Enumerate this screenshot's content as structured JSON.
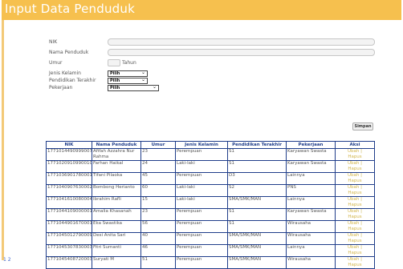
{
  "title": "Input Data Penduduk",
  "form": {
    "nik_label": "NIK",
    "nama_label": "Nama Penduduk",
    "umur_label": "Umur",
    "umur_unit": "Tahun",
    "jk_label": "Jenis Kelamin",
    "jk_value": "Pilih",
    "pendidikan_label": "Pendidikan Terakhir",
    "pendidikan_value": "Pilih",
    "pekerjaan_label": "Pekerjaan",
    "pekerjaan_value": "Pilih",
    "simpan_label": "Simpan"
  },
  "table": {
    "headers": [
      "NIK",
      "Nama Penduduk",
      "Umur",
      "Jenis Kelamin",
      "Pendidikan Terakhir",
      "Pekerjaan",
      "Aksi"
    ],
    "ubah_label": "Ubah",
    "separator": "|",
    "hapus_label": "Hapus",
    "rows": [
      {
        "nik": "1771014490999007",
        "nama": "Afifah Azzahra Nur Rahma",
        "umur": "23",
        "jk": "Perempuan",
        "pend": "S1",
        "kerja": "Karyawan Swasta"
      },
      {
        "nik": "1771020910990010",
        "nama": "Farhan Haikal",
        "umur": "24",
        "jk": "Laki-laki",
        "pend": "S1",
        "kerja": "Karyawan Swasta"
      },
      {
        "nik": "1771036901780001",
        "nama": "Tifani Pilaoka",
        "umur": "45",
        "jk": "Perempuan",
        "pend": "D3",
        "kerja": "Lainnya"
      },
      {
        "nik": "1771040907630002",
        "nama": "Bombong Herianto",
        "umur": "60",
        "jk": "Laki-laki",
        "pend": "S2",
        "kerja": "PNS"
      },
      {
        "nik": "1771041610080004",
        "nama": "Ibrahim Rafli",
        "umur": "15",
        "jk": "Laki-laki",
        "pend": "SMA/SMK/MAN",
        "kerja": "Lainnya"
      },
      {
        "nik": "1771044109000001",
        "nama": "Amalia Khasanah",
        "umur": "23",
        "jk": "Perempuan",
        "pend": "S1",
        "kerja": "Karyawan Swasta"
      },
      {
        "nik": "1771044901670001",
        "nama": "Eka Swastika",
        "umur": "56",
        "jk": "Perempuan",
        "pend": "S1",
        "kerja": "Wirausaha"
      },
      {
        "nik": "1771045012790009",
        "nama": "Desi Anita Sari",
        "umur": "40",
        "jk": "Perempuan",
        "pend": "SMA/SMK/MAN",
        "kerja": "Wirausaha"
      },
      {
        "nik": "1771045307830003",
        "nama": "Fitri Sumanti",
        "umur": "46",
        "jk": "Perempuan",
        "pend": "SMA/SMK/MAN",
        "kerja": "Lainnya"
      },
      {
        "nik": "1771045408720003",
        "nama": "Suryati M",
        "umur": "51",
        "jk": "Perempuan",
        "pend": "SMA/SMK/MAN",
        "kerja": "Wirausaha"
      }
    ]
  },
  "pagination": "1 2"
}
